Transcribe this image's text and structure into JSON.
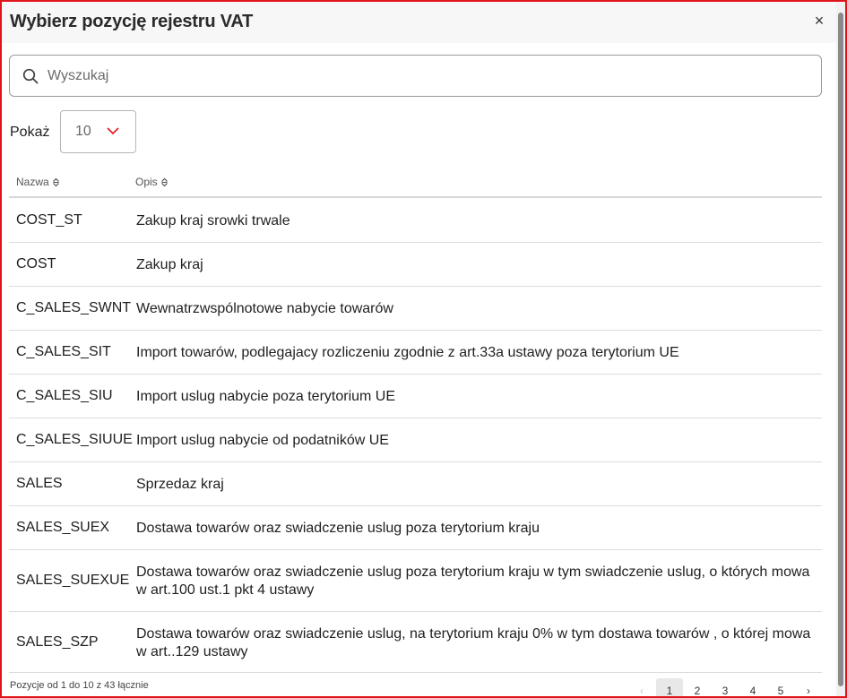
{
  "dialog": {
    "title": "Wybierz pozycję rejestru VAT",
    "close_icon": "×"
  },
  "search": {
    "placeholder": "Wyszukaj",
    "value": "",
    "icon": "search-icon"
  },
  "page_size": {
    "label": "Pokaż",
    "selected": "10",
    "icon": "chevron-down-icon",
    "accent_color": "#e0151b"
  },
  "table": {
    "columns": [
      {
        "label": "Nazwa",
        "icon": "sort-icon"
      },
      {
        "label": "Opis",
        "icon": "sort-icon"
      }
    ],
    "rows": [
      {
        "name": "COST_ST",
        "description": "Zakup kraj srowki trwale"
      },
      {
        "name": "COST",
        "description": "Zakup kraj"
      },
      {
        "name": "C_SALES_SWNT",
        "description": "Wewnatrzwspólnotowe nabycie towarów"
      },
      {
        "name": "C_SALES_SIT",
        "description": "Import towarów, podlegajacy rozliczeniu zgodnie z art.33a ustawy poza terytorium UE"
      },
      {
        "name": "C_SALES_SIU",
        "description": "Import uslug nabycie poza terytorium UE"
      },
      {
        "name": "C_SALES_SIUUE",
        "description": "Import uslug nabycie od podatników UE"
      },
      {
        "name": "SALES",
        "description": "Sprzedaz kraj"
      },
      {
        "name": "SALES_SUEX",
        "description": "Dostawa towarów oraz swiadczenie uslug poza terytorium kraju"
      },
      {
        "name": "SALES_SUEXUE",
        "description": "Dostawa towarów oraz swiadczenie uslug poza terytorium kraju w tym swiadczenie uslug, o których mowa w art.100 ust.1 pkt 4 ustawy"
      },
      {
        "name": "SALES_SZP",
        "description": "Dostawa towarów oraz swiadczenie uslug, na terytorium kraju 0% w tym dostawa towarów , o której mowa w art..129 ustawy"
      }
    ]
  },
  "footer": {
    "info": "Pozycje od 1 do 10 z 43 łącznie"
  },
  "pagination": {
    "prev": "‹",
    "next": "›",
    "pages": [
      "1",
      "2",
      "3",
      "4",
      "5"
    ],
    "current": "1"
  },
  "colors": {
    "frame_border": "#e0151b",
    "header_bg": "#f7f7f7"
  }
}
